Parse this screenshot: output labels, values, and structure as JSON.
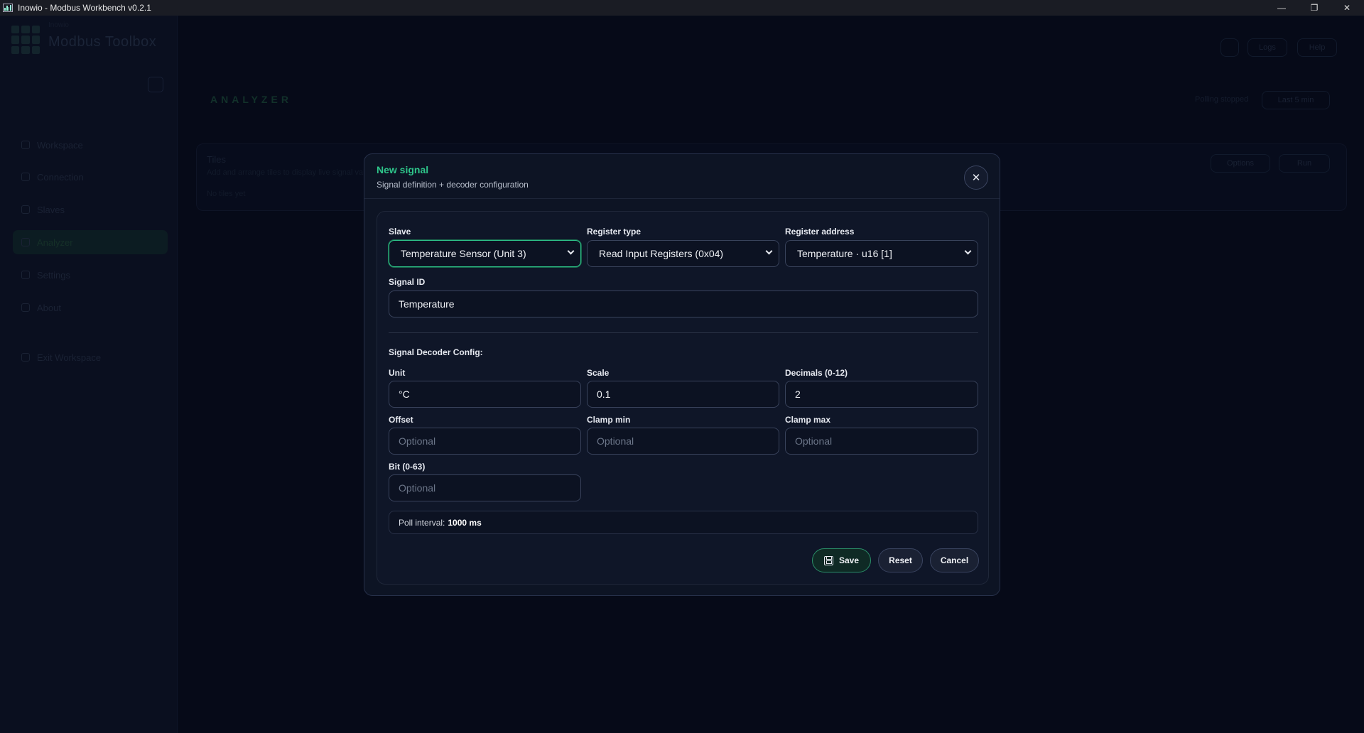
{
  "window": {
    "title": "Inowio - Modbus Workbench v0.2.1",
    "minimize": "—",
    "maximize": "❐",
    "close": "✕"
  },
  "background": {
    "brand_sub": "Inowio",
    "brand": "Modbus Toolbox",
    "nav": [
      {
        "label": "Workspace",
        "icon": "folder-icon"
      },
      {
        "label": "Connection",
        "icon": "link-icon"
      },
      {
        "label": "Slaves",
        "icon": "server-icon"
      },
      {
        "label": "Analyzer",
        "icon": "chart-icon"
      },
      {
        "label": "Settings",
        "icon": "gear-icon"
      },
      {
        "label": "About",
        "icon": "info-icon"
      },
      {
        "label": "Exit Workspace",
        "icon": "exit-icon"
      }
    ],
    "page_title": "ANALYZER",
    "card_title": "Tiles",
    "card_desc": "Add and arrange tiles to display live signal values",
    "card_empty": "No tiles yet",
    "header_btn_a": "Logs",
    "header_btn_b": "Help",
    "header_status": "Polling stopped",
    "header_select": "Last 5 min",
    "card_btn_a": "Options",
    "card_btn_b": "Run"
  },
  "modal": {
    "title": "New signal",
    "subtitle": "Signal definition + decoder configuration",
    "close_label": "✕",
    "slave": {
      "label": "Slave",
      "value": "Temperature Sensor (Unit 3)"
    },
    "register_type": {
      "label": "Register type",
      "value": "Read Input Registers (0x04)"
    },
    "register_address": {
      "label": "Register address",
      "value": "Temperature · u16 [1]"
    },
    "signal_id": {
      "label": "Signal ID",
      "value": "Temperature"
    },
    "decoder_heading": "Signal Decoder Config:",
    "unit": {
      "label": "Unit",
      "value": "°C"
    },
    "scale": {
      "label": "Scale",
      "value": "0.1"
    },
    "decimals": {
      "label": "Decimals (0-12)",
      "value": "2"
    },
    "offset": {
      "label": "Offset",
      "placeholder": "Optional"
    },
    "clamp_min": {
      "label": "Clamp min",
      "placeholder": "Optional"
    },
    "clamp_max": {
      "label": "Clamp max",
      "placeholder": "Optional"
    },
    "bit": {
      "label": "Bit (0-63)",
      "placeholder": "Optional"
    },
    "poll_label": "Poll interval:",
    "poll_value": "1000 ms",
    "buttons": {
      "save": "Save",
      "reset": "Reset",
      "cancel": "Cancel"
    }
  },
  "colors": {
    "accent": "#2ec58a",
    "background": "#060a18",
    "modal": "#0d1424"
  }
}
